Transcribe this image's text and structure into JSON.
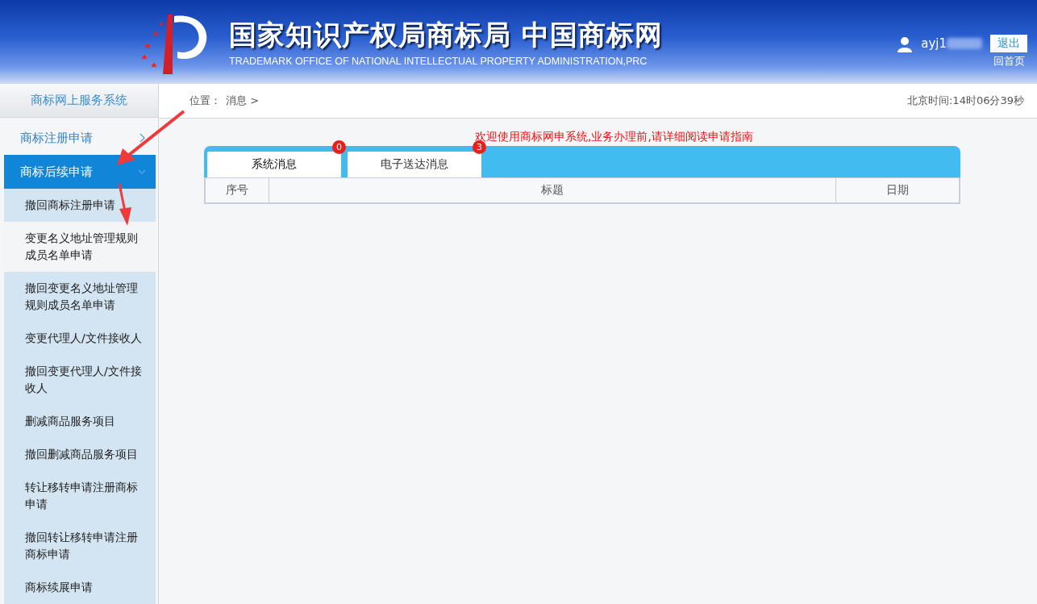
{
  "header": {
    "title": "国家知识产权局商标局 中国商标网",
    "subtitle": "TRADEMARK OFFICE OF NATIONAL INTELLECTUAL PROPERTY ADMINISTRATION,PRC",
    "username": "ayj1",
    "logout": "退出",
    "home_link": "回首页"
  },
  "sidebar": {
    "title": "商标网上服务系统",
    "groups": [
      {
        "label": "商标注册申请",
        "selected": false,
        "expanded": false
      },
      {
        "label": "商标后续申请",
        "selected": true,
        "expanded": true,
        "children": [
          {
            "label": "撤回商标注册申请",
            "selected": false
          },
          {
            "label": "变更名义地址管理规则成员名单申请",
            "selected": true
          },
          {
            "label": "撤回变更名义地址管理规则成员名单申请",
            "selected": false
          },
          {
            "label": "变更代理人/文件接收人",
            "selected": false
          },
          {
            "label": "撤回变更代理人/文件接收人",
            "selected": false
          },
          {
            "label": "删减商品服务项目",
            "selected": false
          },
          {
            "label": "撤回删减商品服务项目",
            "selected": false
          },
          {
            "label": "转让移转申请注册商标申请",
            "selected": false
          },
          {
            "label": "撤回转让移转申请注册商标申请",
            "selected": false
          },
          {
            "label": "商标续展申请",
            "selected": false
          }
        ]
      }
    ]
  },
  "breadcrumb": {
    "label": "位置：",
    "current": "消息 >"
  },
  "clock": "北京时间:14时06分39秒",
  "notice": "欢迎使用商标网申系统,业务办理前,请详细阅读申请指南",
  "tabs": [
    {
      "label": "系统消息",
      "badge": "0",
      "selected": true
    },
    {
      "label": "电子送达消息",
      "badge": "3",
      "selected": false
    }
  ],
  "table": {
    "columns": [
      "序号",
      "标题",
      "日期"
    ]
  }
}
